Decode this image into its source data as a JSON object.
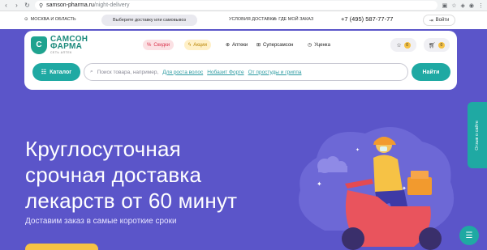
{
  "browser": {
    "url_host": "samson-pharma.ru",
    "url_path": "/night-delivery"
  },
  "topbar": {
    "region": "МОСКВА И ОБЛАСТЬ",
    "delivery_choice": "Выберите доставку или самовывоз",
    "conditions": "УСЛОВИЯ ДОСТАВКИ",
    "where_order": "ГДЕ МОЙ ЗАКАЗ",
    "phone": "+7 (495) 587-77-77",
    "login": "Войти"
  },
  "logo": {
    "line1": "САМСОН",
    "line2": "ФАРМА",
    "tagline": "СЕТЬ АПТЕК"
  },
  "nav": {
    "sale": "Скидки",
    "promo": "Акции",
    "pharmacies": "Аптеки",
    "supersamson": "Суперсамсон",
    "discount": "Уценка"
  },
  "header_buttons": {
    "favorites_count": "0",
    "cart_count": "0"
  },
  "search": {
    "catalog_label": "Каталог",
    "placeholder_prefix": "Поиск товара, например,",
    "links": [
      "Для роста волос",
      "Нобазит Форте",
      "От простуды и гриппа"
    ],
    "find_label": "Найти"
  },
  "hero": {
    "title_lines": [
      "Круглосуточная",
      "срочная доставка",
      "лекарств от 60 минут"
    ],
    "subtitle": "Доставим заказ в самые короткие сроки"
  },
  "side_tab": "Отзыв о сайте",
  "colors": {
    "accent": "#1fa9a3",
    "hero_bg": "#5b55c9",
    "yellow": "#f6c245"
  }
}
